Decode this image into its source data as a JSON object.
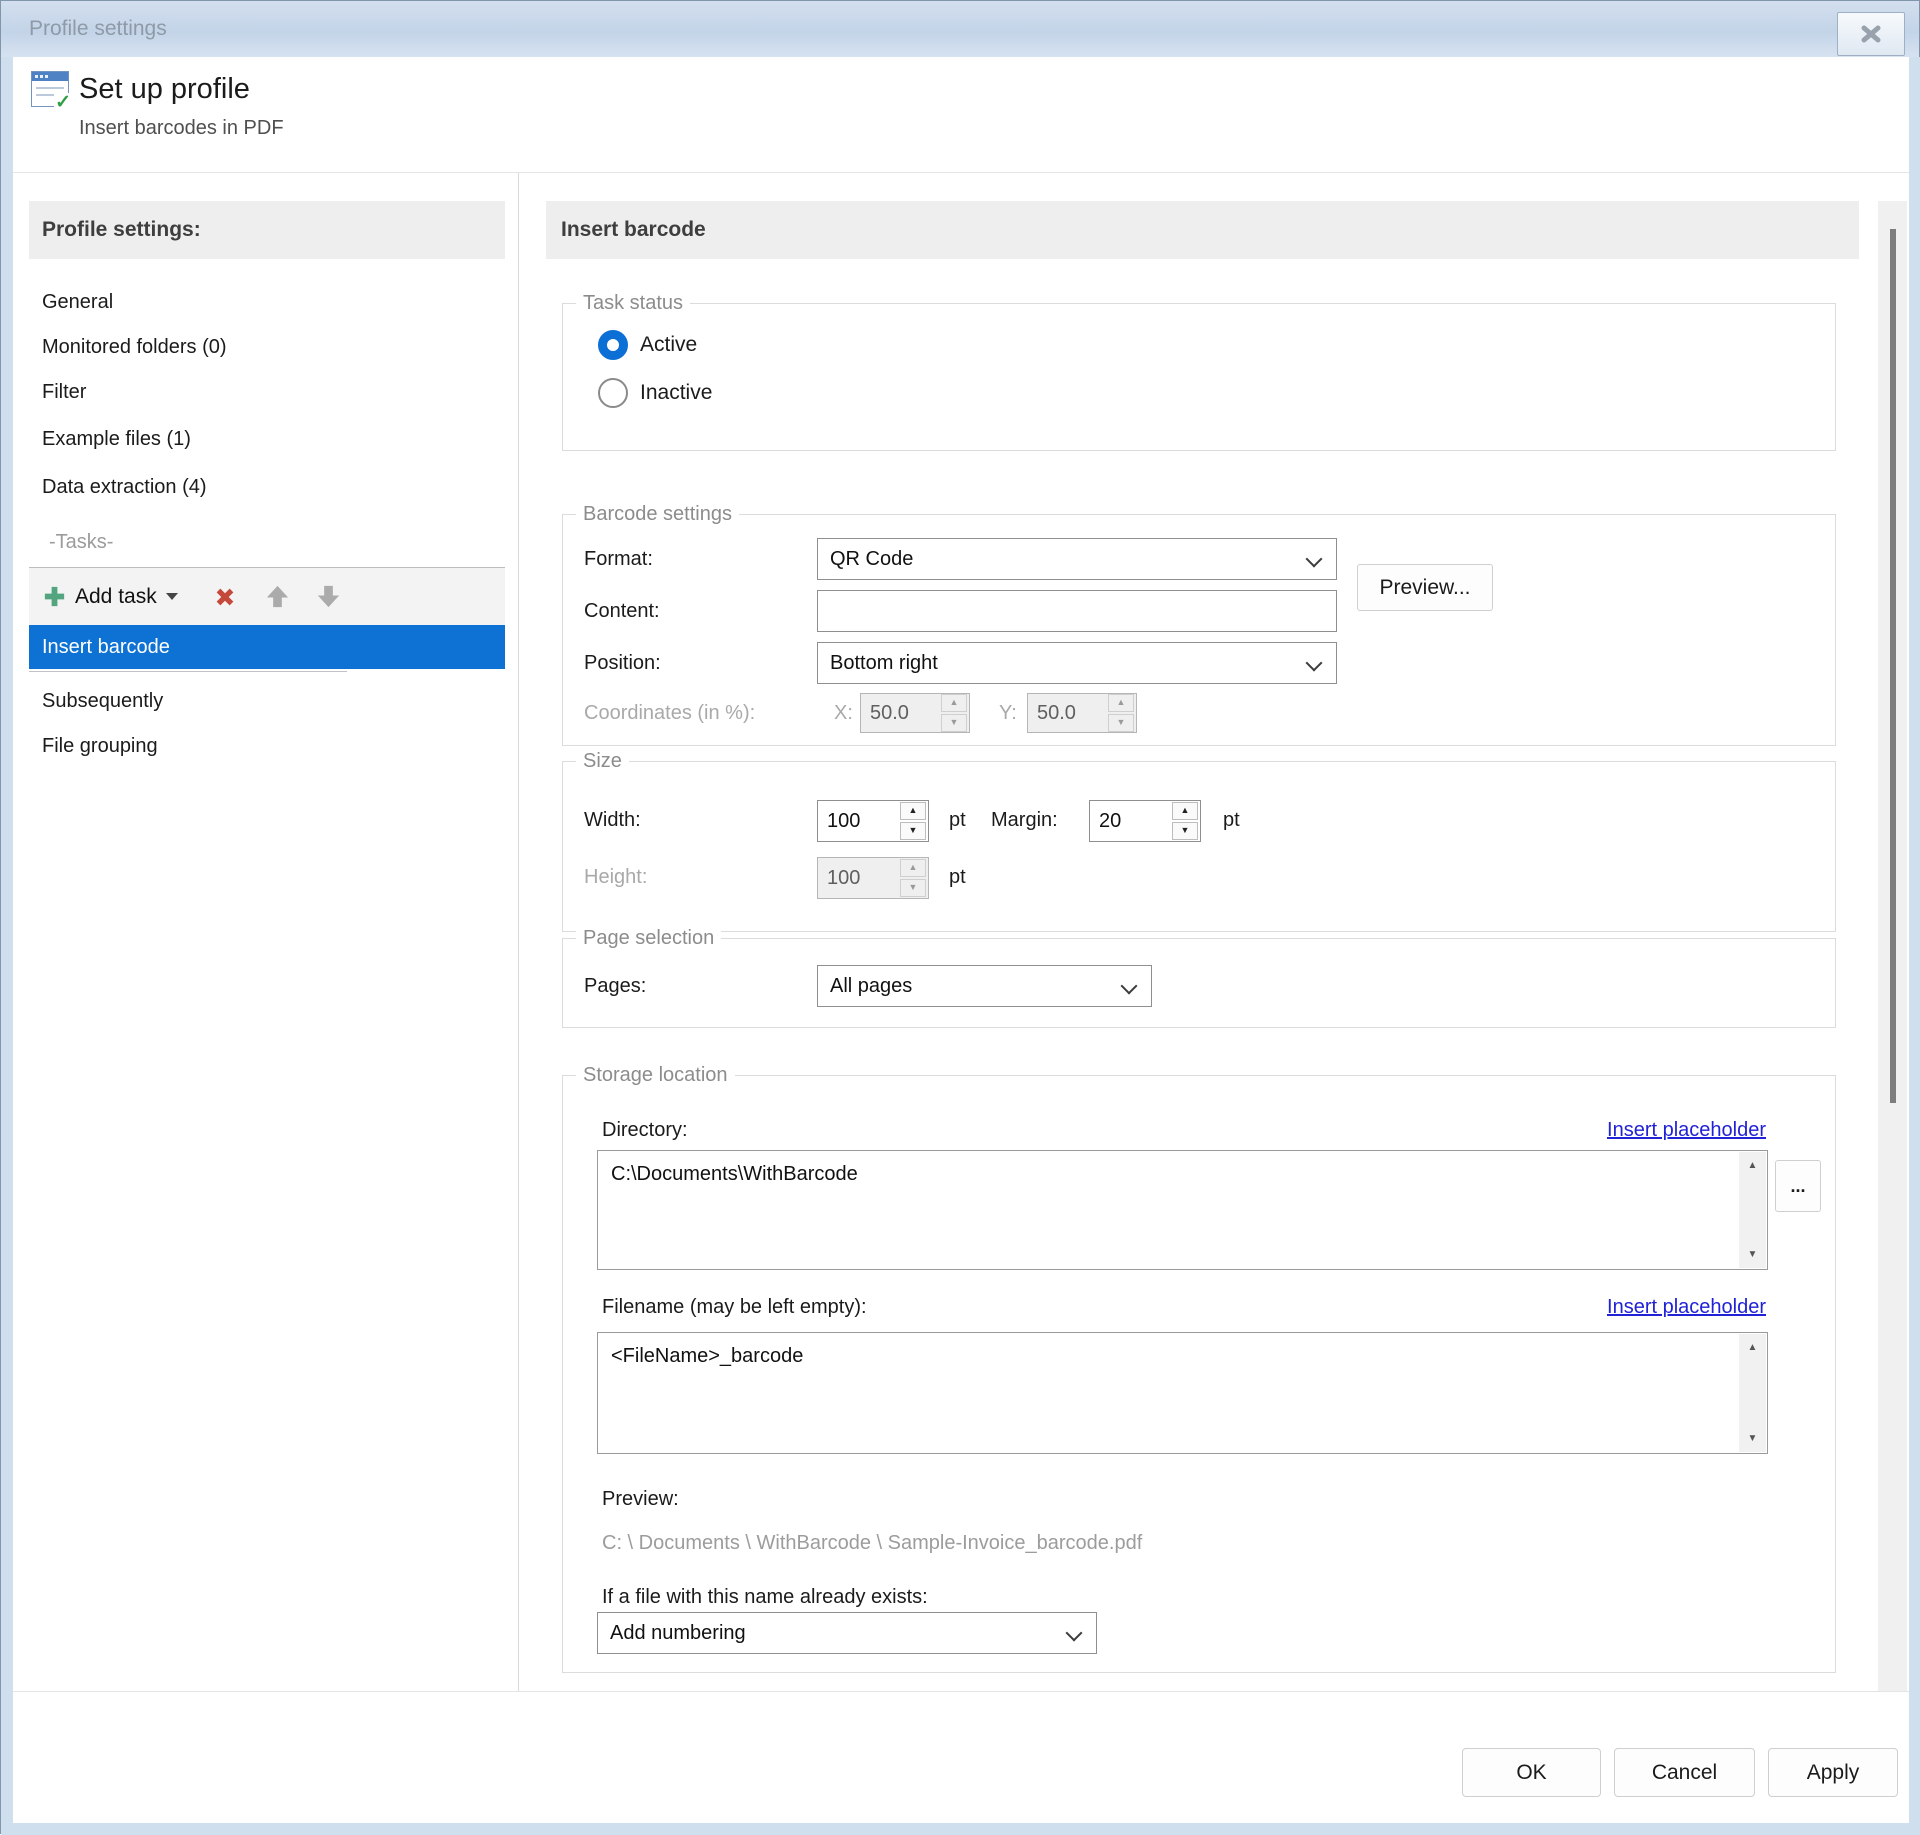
{
  "window": {
    "title": "Profile settings"
  },
  "header": {
    "title": "Set up profile",
    "subtitle": "Insert barcodes in PDF"
  },
  "sidebar": {
    "heading": "Profile settings:",
    "items": [
      "General",
      "Monitored folders (0)",
      "Filter",
      "Example files (1)",
      "Data extraction (4)"
    ],
    "tasks_section_label": "-Tasks-",
    "toolbar": {
      "add_task_label": "Add task"
    },
    "selected_task": "Insert barcode",
    "other_items": [
      "Subsequently",
      "File grouping"
    ]
  },
  "panel": {
    "heading": "Insert barcode",
    "task_status": {
      "legend": "Task status",
      "options": [
        "Active",
        "Inactive"
      ],
      "selected": "Active"
    },
    "barcode_settings": {
      "legend": "Barcode settings",
      "format_label": "Format:",
      "format_value": "QR Code",
      "preview_button_label": "Preview...",
      "content_label": "Content:",
      "content_value": "",
      "position_label": "Position:",
      "position_value": "Bottom right",
      "coordinates_label": "Coordinates (in %):",
      "x_label": "X:",
      "x_value": "50.0",
      "y_label": "Y:",
      "y_value": "50.0"
    },
    "size": {
      "legend": "Size",
      "width_label": "Width:",
      "width_value": "100",
      "unit": "pt",
      "margin_label": "Margin:",
      "margin_value": "20",
      "height_label": "Height:",
      "height_value": "100"
    },
    "page_selection": {
      "legend": "Page selection",
      "pages_label": "Pages:",
      "pages_value": "All pages"
    },
    "storage": {
      "legend": "Storage location",
      "directory_label": "Directory:",
      "insert_placeholder_label": "Insert placeholder",
      "directory_value": "C:\\Documents\\WithBarcode",
      "browse_label": "...",
      "filename_label": "Filename (may be left empty):",
      "filename_value": "<FileName>_barcode",
      "preview_label": "Preview:",
      "preview_path": "C: \\ Documents \\ WithBarcode \\ Sample-Invoice_barcode.pdf",
      "exists_label": "If a file with this name already exists:",
      "exists_value": "Add numbering"
    }
  },
  "footer": {
    "ok": "OK",
    "cancel": "Cancel",
    "apply": "Apply"
  },
  "icons": {
    "up": "▲",
    "down": "▼",
    "check": "✓"
  },
  "colors": {
    "selection_blue": "#0e72d4",
    "radio_accent": "#0c6fd6",
    "link_blue": "#2121d6",
    "add_green": "#53a57f",
    "delete_red": "#c4493a",
    "titlebar_blue": "#c3d4e8"
  }
}
